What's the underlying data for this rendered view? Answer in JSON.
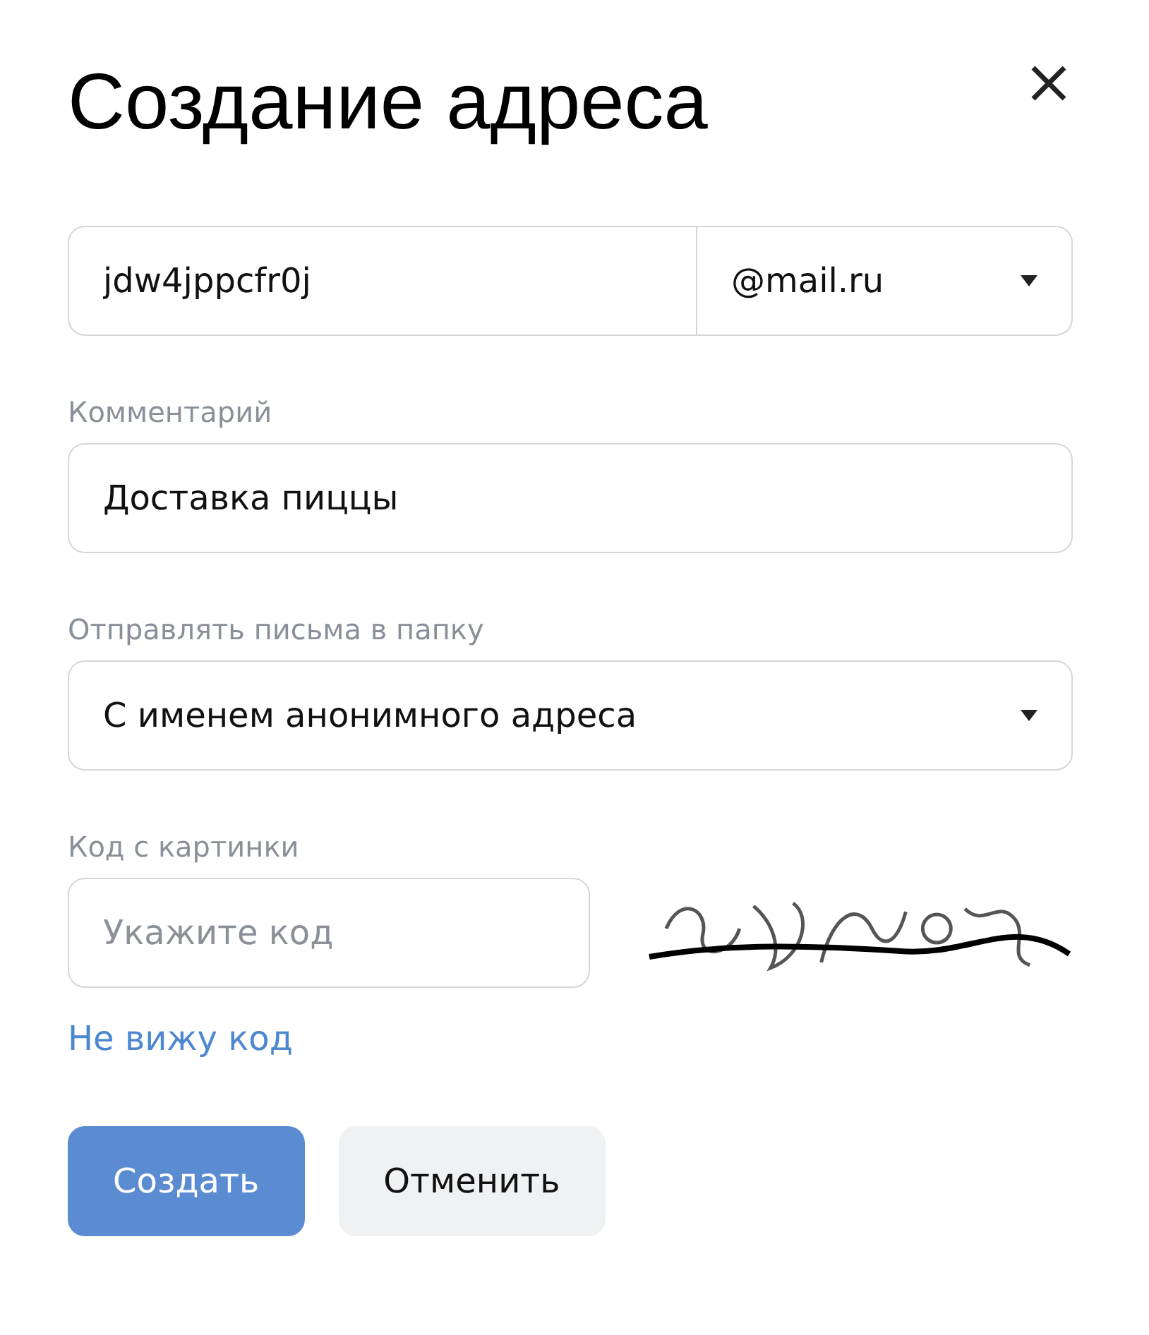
{
  "title": "Создание адреса",
  "email": {
    "value": "jdw4jppcfr0j",
    "domain": "@mail.ru"
  },
  "comment": {
    "label": "Комментарий",
    "value": "Доставка пиццы"
  },
  "folder": {
    "label": "Отправлять письма в папку",
    "value": "С именем анонимного адреса"
  },
  "captcha": {
    "label": "Код с картинки",
    "placeholder": "Укажите код",
    "link": "Не вижу код"
  },
  "buttons": [
    {
      "label": "Создать",
      "kind": "primary"
    },
    {
      "label": "Отменить",
      "kind": "secondary"
    }
  ]
}
